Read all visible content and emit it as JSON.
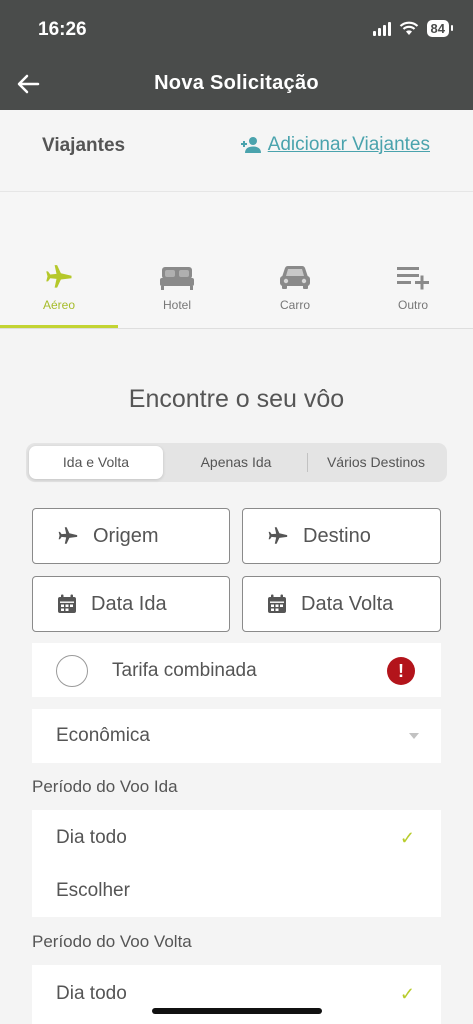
{
  "status_bar": {
    "time": "16:26",
    "battery": "84"
  },
  "header": {
    "title": "Nova Solicitação"
  },
  "travelers": {
    "label": "Viajantes",
    "add_link": "Adicionar Viajantes"
  },
  "tabs": [
    {
      "label": "Aéreo",
      "icon": "airplane-icon"
    },
    {
      "label": "Hotel",
      "icon": "bed-icon"
    },
    {
      "label": "Carro",
      "icon": "car-icon"
    },
    {
      "label": "Outro",
      "icon": "add-list-icon"
    }
  ],
  "colors": {
    "accent": "#c3d433",
    "link": "#4aa3ad",
    "header_bg": "#4a4c4b",
    "alert": "#b3141b"
  },
  "main": {
    "heading": "Encontre o seu vôo",
    "trip_types": [
      "Ida e Volta",
      "Apenas Ida",
      "Vários Destinos"
    ],
    "fields": {
      "origin": "Origem",
      "destination": "Destino",
      "departure_date": "Data Ida",
      "return_date": "Data Volta"
    },
    "combined_fare": {
      "label": "Tarifa combinada",
      "alert": "!"
    },
    "cabin_class": "Econômica",
    "outbound_period": {
      "label": "Período do Voo Ida",
      "options": [
        "Dia todo",
        "Escolher"
      ]
    },
    "return_period": {
      "label": "Período do Voo Volta",
      "options": [
        "Dia todo"
      ]
    },
    "check_mark": "✓"
  }
}
